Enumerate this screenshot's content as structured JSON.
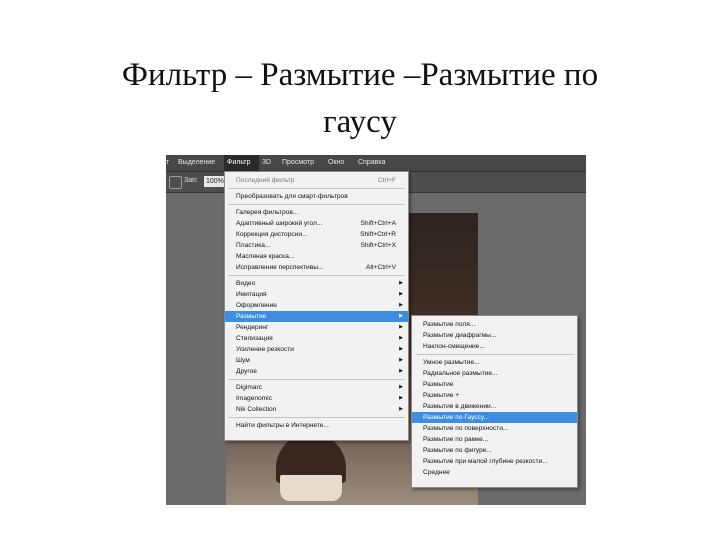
{
  "slide": {
    "title_line1": "Фильтр – Размытие –Размытие по",
    "title_line2": "гаусу"
  },
  "menubar": [
    {
      "label": "т"
    },
    {
      "label": "Выделение"
    },
    {
      "label": "Фильтр",
      "active": true
    },
    {
      "label": "3D"
    },
    {
      "label": "Просмотр"
    },
    {
      "label": "Окно"
    },
    {
      "label": "Справка"
    }
  ],
  "options": {
    "label": "Зап:",
    "value": "100%"
  },
  "filter_menu": {
    "items": [
      {
        "label": "Последний фильтр",
        "shortcut": "Ctrl+F",
        "dim": true
      },
      {
        "sep": true
      },
      {
        "label": "Преобразовать для смарт-фильтров"
      },
      {
        "sep": true
      },
      {
        "label": "Галерея фильтров..."
      },
      {
        "label": "Адаптивный широкий угол...",
        "shortcut": "Shift+Ctrl+A"
      },
      {
        "label": "Коррекция дисторсии...",
        "shortcut": "Shift+Ctrl+R"
      },
      {
        "label": "Пластика...",
        "shortcut": "Shift+Ctrl+X"
      },
      {
        "label": "Масляная краска..."
      },
      {
        "label": "Исправление перспективы...",
        "shortcut": "Alt+Ctrl+V"
      },
      {
        "sep": true
      },
      {
        "label": "Видео",
        "sub": true
      },
      {
        "label": "Имитация",
        "sub": true
      },
      {
        "label": "Оформление",
        "sub": true
      },
      {
        "label": "Размытие",
        "sub": true,
        "hl": true
      },
      {
        "label": "Рендеринг",
        "sub": true
      },
      {
        "label": "Стилизация",
        "sub": true
      },
      {
        "label": "Усиление резкости",
        "sub": true
      },
      {
        "label": "Шум",
        "sub": true
      },
      {
        "label": "Другое",
        "sub": true
      },
      {
        "sep": true
      },
      {
        "label": "Digimarc",
        "sub": true
      },
      {
        "label": "Imagenomic",
        "sub": true
      },
      {
        "label": "Nik Collection",
        "sub": true
      },
      {
        "sep": true
      },
      {
        "label": "Найти фильтры в Интернете..."
      }
    ]
  },
  "blur_submenu": {
    "items": [
      {
        "label": "Размытие поля..."
      },
      {
        "label": "Размытие диафрагмы..."
      },
      {
        "label": "Наклон-смещение..."
      },
      {
        "sep": true
      },
      {
        "label": "Умное размытие..."
      },
      {
        "label": "Радиальное размытие..."
      },
      {
        "label": "Размытие"
      },
      {
        "label": "Размытие +"
      },
      {
        "label": "Размытие в движении..."
      },
      {
        "label": "Размытие по Гауссу...",
        "hl": true
      },
      {
        "label": "Размытие по поверхности..."
      },
      {
        "label": "Размытие по рамке..."
      },
      {
        "label": "Размытие по фигуре..."
      },
      {
        "label": "Размытие при малой глубине резкости..."
      },
      {
        "label": "Среднее"
      }
    ]
  }
}
